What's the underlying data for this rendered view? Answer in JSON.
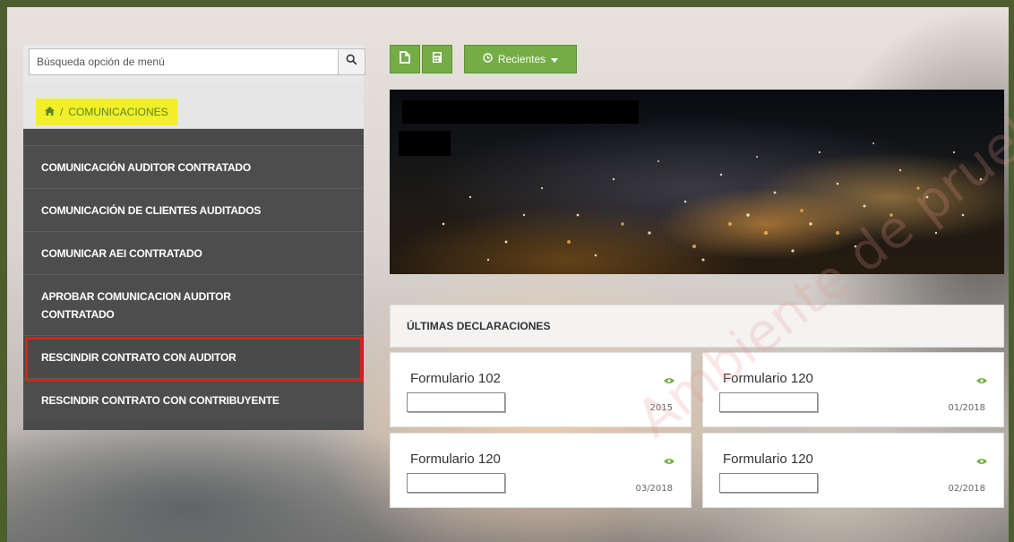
{
  "search": {
    "placeholder": "Búsqueda opción de menú",
    "icon": "search-icon"
  },
  "breadcrumb": {
    "icon": "home-icon",
    "separator": "/",
    "label": "COMUNICACIONES"
  },
  "menu": {
    "items": [
      {
        "label": "COMUNICACIÓN AUDITOR CONTRATADO"
      },
      {
        "label": "COMUNICACIÓN DE CLIENTES AUDITADOS"
      },
      {
        "label": "COMUNICAR AEI CONTRATADO"
      },
      {
        "label": "APROBAR COMUNICACION AUDITOR CONTRATADO"
      },
      {
        "label": "RESCINDIR CONTRATO CON AUDITOR",
        "highlighted": true
      },
      {
        "label": "RESCINDIR CONTRATO CON CONTRIBUYENTE"
      }
    ]
  },
  "toolbar": {
    "buttons": [
      {
        "icon": "document-icon"
      },
      {
        "icon": "calculator-icon"
      }
    ],
    "recent_label": "Recientes",
    "recent_icon": "clock-icon"
  },
  "declarations": {
    "header": "ÚLTIMAS DECLARACIONES",
    "cards": [
      {
        "title": "Formulario 102",
        "period": "2015"
      },
      {
        "title": "Formulario 120",
        "period": "01/2018"
      },
      {
        "title": "Formulario 120",
        "period": "03/2018"
      },
      {
        "title": "Formulario 120",
        "period": "02/2018"
      }
    ]
  },
  "watermark": "Ambiente de pruebas",
  "colors": {
    "frame": "#4c5e2e",
    "accent_green": "#74ad46",
    "sidebar_bg": "#4a4a4a",
    "crumb_highlight": "#f1ee2a",
    "red_box": "#e01d1d"
  }
}
